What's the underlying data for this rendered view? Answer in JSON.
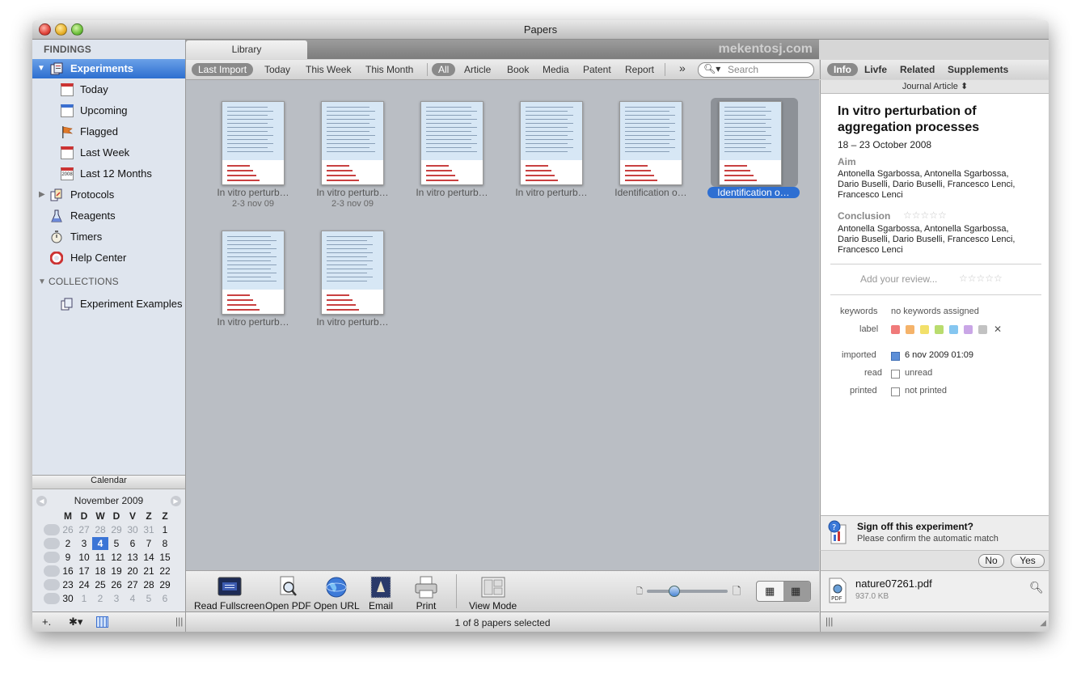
{
  "window": {
    "title": "Papers",
    "watermark": "mekentosj.com"
  },
  "sidebar": {
    "findings_header": "FINDINGS",
    "items": [
      {
        "label": "Experiments",
        "icon": "experiments-icon"
      },
      {
        "label": "Today",
        "icon": "calendar-icon"
      },
      {
        "label": "Upcoming",
        "icon": "calendar-upcoming-icon"
      },
      {
        "label": "Flagged",
        "icon": "flag-icon"
      },
      {
        "label": "Last Week",
        "icon": "calendar-icon"
      },
      {
        "label": "Last 12 Months",
        "icon": "calendar-year-icon",
        "icon_text": "2008"
      },
      {
        "label": "Protocols",
        "icon": "protocols-icon"
      },
      {
        "label": "Reagents",
        "icon": "flask-icon"
      },
      {
        "label": "Timers",
        "icon": "stopwatch-icon"
      },
      {
        "label": "Help Center",
        "icon": "lifebuoy-icon"
      }
    ],
    "collections_header": "COLLECTIONS",
    "collections": [
      {
        "label": "Experiment Examples",
        "icon": "collection-icon"
      }
    ]
  },
  "calendar": {
    "title": "Calendar",
    "month": "November 2009",
    "weekdays": [
      "M",
      "D",
      "W",
      "D",
      "V",
      "Z",
      "Z"
    ],
    "weeks": [
      [
        [
          "26",
          "dim"
        ],
        [
          "27",
          "dim"
        ],
        [
          "28",
          "dim"
        ],
        [
          "29",
          "dim"
        ],
        [
          "30",
          "dim"
        ],
        [
          "31",
          "dim"
        ],
        [
          "1",
          ""
        ]
      ],
      [
        [
          "2",
          ""
        ],
        [
          "3",
          ""
        ],
        [
          "4",
          "today"
        ],
        [
          "5",
          ""
        ],
        [
          "6",
          ""
        ],
        [
          "7",
          ""
        ],
        [
          "8",
          ""
        ]
      ],
      [
        [
          "9",
          ""
        ],
        [
          "10",
          ""
        ],
        [
          "11",
          ""
        ],
        [
          "12",
          ""
        ],
        [
          "13",
          ""
        ],
        [
          "14",
          ""
        ],
        [
          "15",
          ""
        ]
      ],
      [
        [
          "16",
          ""
        ],
        [
          "17",
          ""
        ],
        [
          "18",
          ""
        ],
        [
          "19",
          ""
        ],
        [
          "20",
          ""
        ],
        [
          "21",
          ""
        ],
        [
          "22",
          ""
        ]
      ],
      [
        [
          "23",
          ""
        ],
        [
          "24",
          ""
        ],
        [
          "25",
          ""
        ],
        [
          "26",
          ""
        ],
        [
          "27",
          ""
        ],
        [
          "28",
          ""
        ],
        [
          "29",
          ""
        ]
      ],
      [
        [
          "30",
          ""
        ],
        [
          "1",
          "dim"
        ],
        [
          "2",
          "dim"
        ],
        [
          "3",
          "dim"
        ],
        [
          "4",
          "dim"
        ],
        [
          "5",
          "dim"
        ],
        [
          "6",
          "dim"
        ]
      ]
    ]
  },
  "library_tab": "Library",
  "filters": {
    "time": [
      "Last Import",
      "Today",
      "This Week",
      "This Month"
    ],
    "types": [
      "All",
      "Article",
      "Book",
      "Media",
      "Patent",
      "Report"
    ],
    "more": "»",
    "search_placeholder": "Search"
  },
  "papers": [
    {
      "title": "In vitro perturb…",
      "date": "2-3 nov 09"
    },
    {
      "title": "In vitro perturb…",
      "date": "2-3 nov 09"
    },
    {
      "title": "In vitro perturb…",
      "date": ""
    },
    {
      "title": "In vitro perturb…",
      "date": ""
    },
    {
      "title": "Identification o…",
      "date": ""
    },
    {
      "title": "Identification o…",
      "date": "",
      "selected": true
    },
    {
      "title": "In vitro perturb…",
      "date": ""
    },
    {
      "title": "In vitro perturb…",
      "date": ""
    }
  ],
  "toolbar": {
    "read_fullscreen": "Read Fullscreen",
    "open_pdf": "Open PDF",
    "open_url": "Open URL",
    "email": "Email",
    "print": "Print",
    "view_mode": "View Mode"
  },
  "status": "1 of 8 papers selected",
  "info_panel": {
    "tabs": [
      "Info",
      "Livfe",
      "Related",
      "Supplements"
    ],
    "type": "Journal Article ⬍",
    "title": "In vitro perturbation of aggregation processes",
    "title_line1": "In vitro perturbation of",
    "title_line2": "aggregation processes",
    "dates": "18 – 23 October 2008",
    "aim_label": "Aim",
    "aim_lines": [
      "Antonella Sgarbossa, Antonella Sgarbossa,",
      "Dario Buselli, Dario Buselli, Francesco Lenci,",
      "Francesco Lenci"
    ],
    "conclusion_label": "Conclusion",
    "conclusion_lines": [
      "Antonella Sgarbossa, Antonella Sgarbossa,",
      "Dario Buselli, Dario Buselli, Francesco Lenci,",
      "Francesco Lenci"
    ],
    "stars": "☆☆☆☆☆",
    "add_review": "Add your review...",
    "keywords_label": "keywords",
    "keywords_value": "no keywords assigned",
    "label_label": "label",
    "label_colors": [
      "#f07a7a",
      "#f5b36a",
      "#f2e06a",
      "#b9dc6e",
      "#85c6f0",
      "#c9a6e6",
      "#c2c2c2"
    ],
    "label_clear": "✕",
    "imported_label": "imported",
    "imported_value": "6 nov 2009 01:09",
    "read_label": "read",
    "read_value": "unread",
    "printed_label": "printed",
    "printed_value": "not printed",
    "sign_title": "Sign off this experiment?",
    "sign_sub": "Please confirm the automatic match",
    "no": "No",
    "yes": "Yes",
    "file_name": "nature07261.pdf",
    "file_size": "937.0 KB",
    "file_badge": "PDF"
  }
}
